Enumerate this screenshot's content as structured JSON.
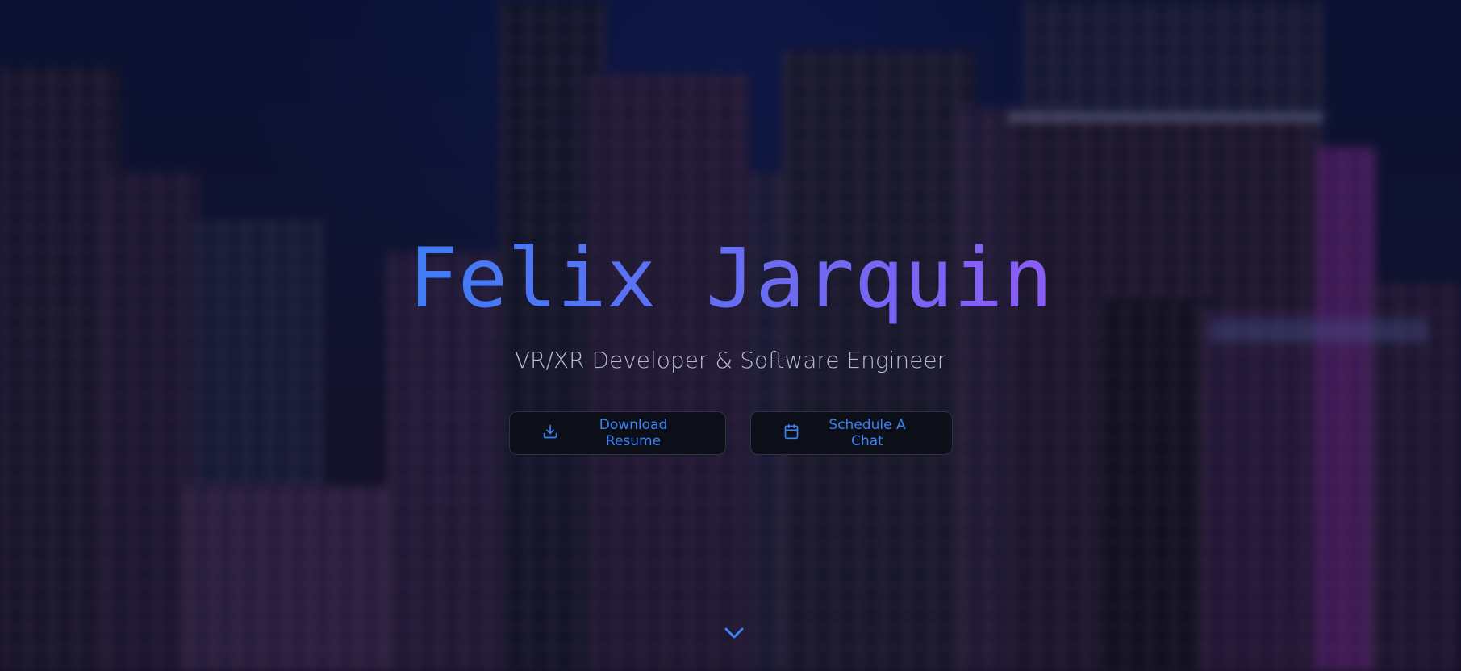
{
  "hero": {
    "name": "Felix Jarquin",
    "tagline": "VR/XR Developer & Software Engineer"
  },
  "actions": {
    "resume_label": "Download Resume",
    "resume_icon": "download-icon",
    "chat_label": "Schedule A Chat",
    "chat_icon": "calendar-icon"
  },
  "scroll": {
    "icon": "chevron-down-icon"
  },
  "colors": {
    "accent": "#3b82f6",
    "gradient_start": "#3f7cf5",
    "gradient_end": "#8b5cf6",
    "button_bg": "#0c0f18",
    "subtitle": "#b6bccd"
  }
}
